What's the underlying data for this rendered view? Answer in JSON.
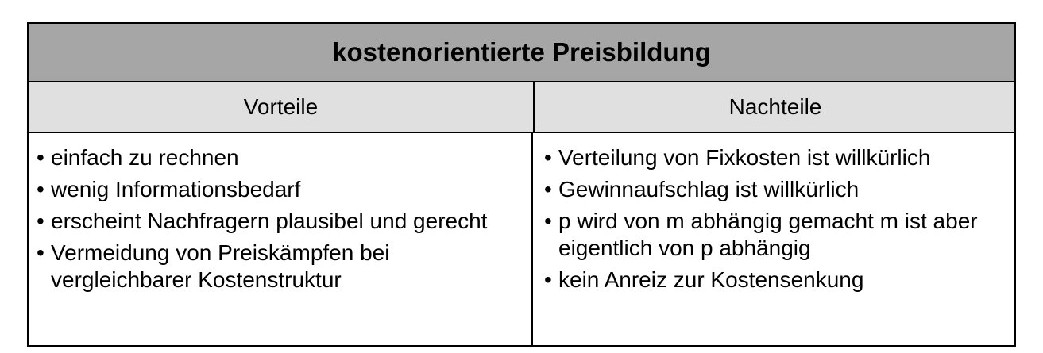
{
  "table": {
    "title": "kostenorientierte Preisbildung",
    "headers": {
      "left": "Vorteile",
      "right": "Nachteile"
    },
    "vorteile": [
      "einfach zu rechnen",
      "wenig Informationsbedarf",
      "erscheint Nachfragern plausibel und gerecht",
      "Vermeidung von Preiskämpfen bei vergleichbarer Kostenstruktur"
    ],
    "nachteile": [
      "Verteilung von Fixkosten ist willkürlich",
      "Gewinnaufschlag ist willkürlich",
      "p wird von m abhängig gemacht m ist aber eigentlich von p abhängig",
      "kein Anreiz zur Kostensenkung"
    ]
  }
}
